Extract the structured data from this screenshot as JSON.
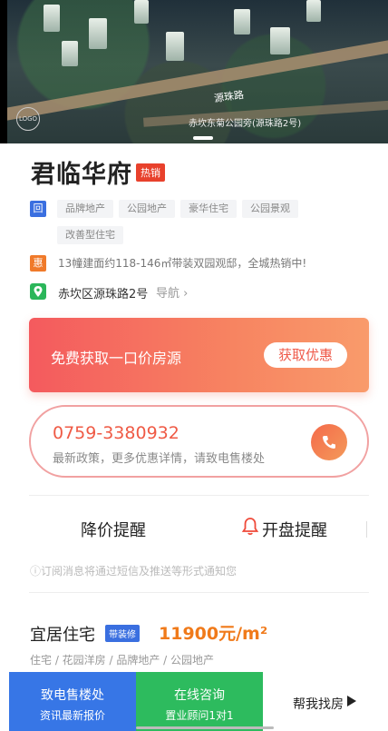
{
  "hero": {
    "road_label": "源珠路",
    "caption": "赤坎东菊公园旁(源珠路2号)"
  },
  "project": {
    "name": "君临华府",
    "status_badge": "热销",
    "tags": [
      "品牌地产",
      "公园地产",
      "豪华住宅",
      "公园景观",
      "改善型住宅"
    ],
    "tag_icon": "回",
    "promo_icon": "惠",
    "promo_text": "13幢建面约118-146㎡带装双园观邸，全城热销中!",
    "address": "赤坎区源珠路2号",
    "nav_label": "导航"
  },
  "banner": {
    "text": "免费获取一口价房源",
    "button": "获取优惠"
  },
  "phone": {
    "number": "0759-3380932",
    "subtitle": "最新政策，更多优惠详情，请致电售楼处"
  },
  "reminders": {
    "price_drop": "降价提醒",
    "opening": "开盘提醒",
    "notice": "ⓘ订阅消息将通过短信及推送等形式通知您"
  },
  "listing": {
    "type": "宜居住宅",
    "decoration": "带装修",
    "price": "11900元/m²",
    "sub_tags": "住宅 / 花园洋房 / 品牌地产 / 公园地产"
  },
  "bottom_bar": {
    "call_title": "致电售楼处",
    "call_sub": "资讯最新报价",
    "chat_title": "在线咨询",
    "chat_sub": "置业顾问1对1",
    "find_label": "帮我找房"
  },
  "colors": {
    "accent_red": "#e8412c",
    "brand_blue": "#3776e6",
    "brand_green": "#2dbb5e",
    "price_orange": "#f07a1a"
  }
}
